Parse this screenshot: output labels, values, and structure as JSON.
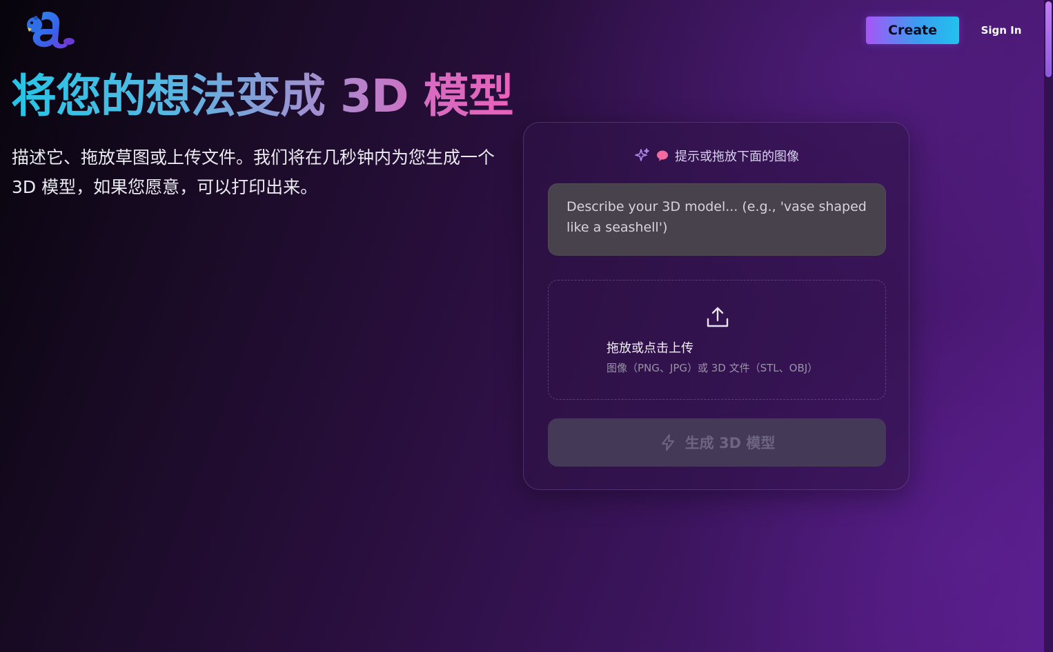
{
  "header": {
    "create_label": "Create",
    "signin_label": "Sign In",
    "logo_icon": "beaver-a-logo-icon"
  },
  "hero": {
    "title": "将您的想法变成 3D 模型",
    "subtitle": "描述它、拖放草图或上传文件。我们将在几秒钟内为您生成一个 3D 模型，如果您愿意，可以打印出来。"
  },
  "card": {
    "header_text": "提示或拖放下面的图像",
    "header_icons": [
      "sparkle-icon",
      "speech-bubble-icon"
    ],
    "prompt": {
      "value": "",
      "placeholder": "Describe your 3D model... (e.g., 'vase shaped like a seashell')"
    },
    "dropzone": {
      "icon": "upload-icon",
      "title": "拖放或点击上传",
      "hint": "图像（PNG、JPG）或 3D 文件（STL、OBJ）"
    },
    "generate": {
      "icon": "lightning-bolt-icon",
      "label": "生成 3D 模型",
      "disabled": true
    }
  },
  "colors": {
    "accent_gradient_start": "#a855f7",
    "accent_gradient_end": "#22c2ee",
    "title_gradient_start": "#25c5e6",
    "title_gradient_end": "#ec5fba",
    "card_bg": "#2e1246",
    "prompt_bg": "#47424c",
    "button_disabled_bg": "#443a57"
  }
}
